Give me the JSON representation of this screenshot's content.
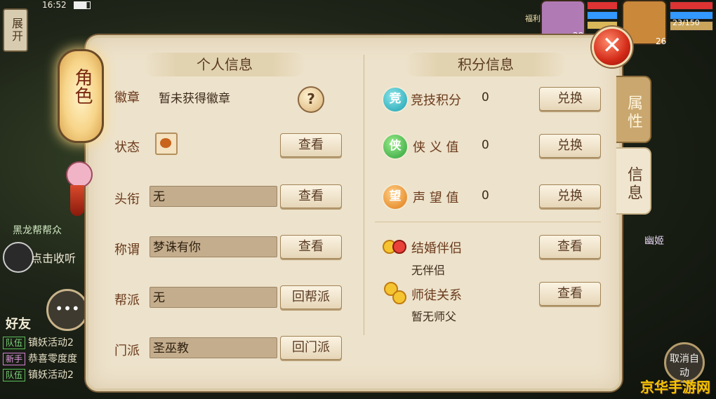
{
  "status_bar": {
    "time": "16:52"
  },
  "hud": {
    "expand_label": "展开",
    "left_character_name": "黑龙帮帮众",
    "listen_label": "点击收听",
    "friends_label": "好友",
    "right_character_name": "幽姬",
    "cancel_auto_label": "取消自动",
    "bar_level_1": "28",
    "bar_level_2": "26",
    "bar_counter": "23/150",
    "welfare_label": "福利",
    "chat": [
      {
        "tag": "队伍",
        "tag_type": "team",
        "text": "镇妖活动2"
      },
      {
        "tag": "新手",
        "tag_type": "new",
        "text": "恭喜零度度"
      },
      {
        "tag": "队伍",
        "tag_type": "team",
        "text": "镇妖活动2"
      }
    ]
  },
  "lantern": {
    "text": "角色"
  },
  "tabs": [
    {
      "label": "属性",
      "active": false
    },
    {
      "label": "信息",
      "active": true
    }
  ],
  "personal": {
    "title": "个人信息",
    "badge": {
      "label": "徽章",
      "value": "暂未获得徽章",
      "help_icon": "question-icon"
    },
    "status": {
      "label": "状态",
      "icon": "chicken-leg-icon",
      "button": "查看"
    },
    "rank": {
      "label": "头衔",
      "value": "无",
      "button": "查看"
    },
    "appellation": {
      "label": "称谓",
      "value": "梦诛有你",
      "button": "查看"
    },
    "guild": {
      "label": "帮派",
      "value": "无",
      "button": "回帮派"
    },
    "sect": {
      "label": "门派",
      "value": "圣巫教",
      "button": "回门派"
    }
  },
  "points": {
    "title": "积分信息",
    "arena": {
      "icon_char": "竞",
      "label": "竞技积分",
      "value": "0",
      "button": "兑换",
      "color": "#18a0b0"
    },
    "chivalry": {
      "icon_char": "侠",
      "label": "侠 义 值",
      "value": "0",
      "button": "兑换",
      "color": "#2aa038"
    },
    "prestige": {
      "icon_char": "望",
      "label": "声 望 值",
      "value": "0",
      "button": "兑换",
      "color": "#e07a12"
    },
    "marriage": {
      "label": "结婚伴侣",
      "value": "无伴侣",
      "button": "查看"
    },
    "mentor": {
      "label": "师徒关系",
      "value": "暂无师父",
      "button": "查看"
    }
  },
  "close_label": "✕",
  "watermark": "京华手游网"
}
